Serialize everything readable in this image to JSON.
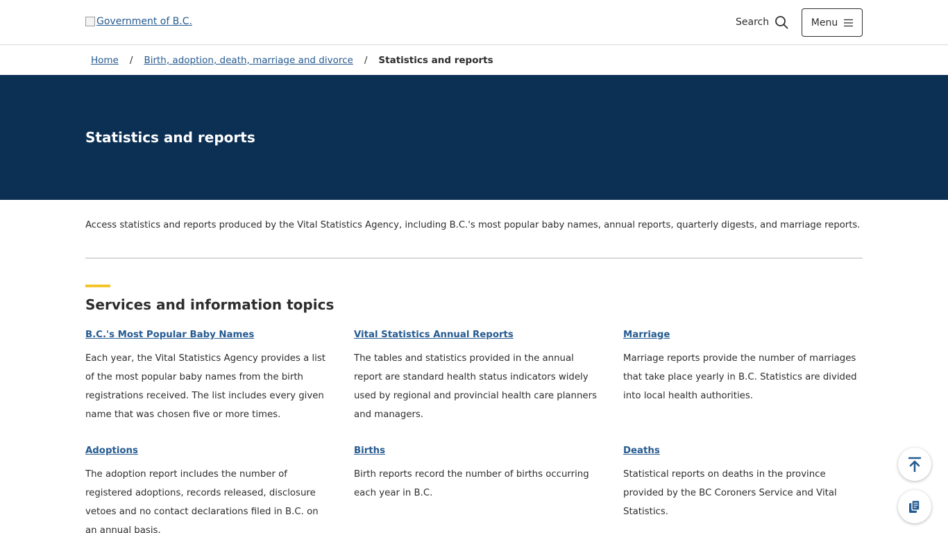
{
  "header": {
    "logo_alt": "Government of B.C.",
    "search_label": "Search",
    "menu_label": "Menu"
  },
  "breadcrumb": {
    "home": "Home",
    "parent": "Birth, adoption, death, marriage and divorce",
    "current": "Statistics and reports",
    "separator": "/"
  },
  "page": {
    "title": "Statistics and reports",
    "intro": "Access statistics and reports produced by the Vital Statistics Agency, including B.C.'s most popular baby names, annual reports, quarterly digests, and marriage reports.",
    "section_title": "Services and information topics"
  },
  "topics": [
    {
      "title": "B.C.'s Most Popular Baby Names",
      "description": "Each year, the Vital Statistics Agency provides a list of the most popular baby names from the birth registrations received. The list includes every given name that was chosen five or more times."
    },
    {
      "title": "Vital Statistics Annual Reports",
      "description": "The tables and statistics provided in the annual report are standard health status indicators widely used by regional and provincial health care planners and managers."
    },
    {
      "title": "Marriage",
      "description": "Marriage reports provide the number of marriages that take place yearly in B.C. Statistics are divided into local health authorities."
    },
    {
      "title": "Adoptions",
      "description": "The adoption report includes the number of registered adoptions, records released, disclosure vetoes and no contact declarations filed in B.C. on an annual basis."
    },
    {
      "title": "Births",
      "description": "Birth reports record the number of births occurring each year in B.C."
    },
    {
      "title": "Deaths",
      "description": "Statistical reports on deaths in the province provided by the BC Coroners Service and Vital Statistics."
    }
  ],
  "colors": {
    "banner": "#0c2f54",
    "link": "#255a90",
    "accent": "#f3c52a"
  },
  "icons": {
    "search": "search-icon",
    "menu": "hamburger-icon",
    "back_to_top": "back-to-top-icon",
    "copy": "copy-icon"
  }
}
